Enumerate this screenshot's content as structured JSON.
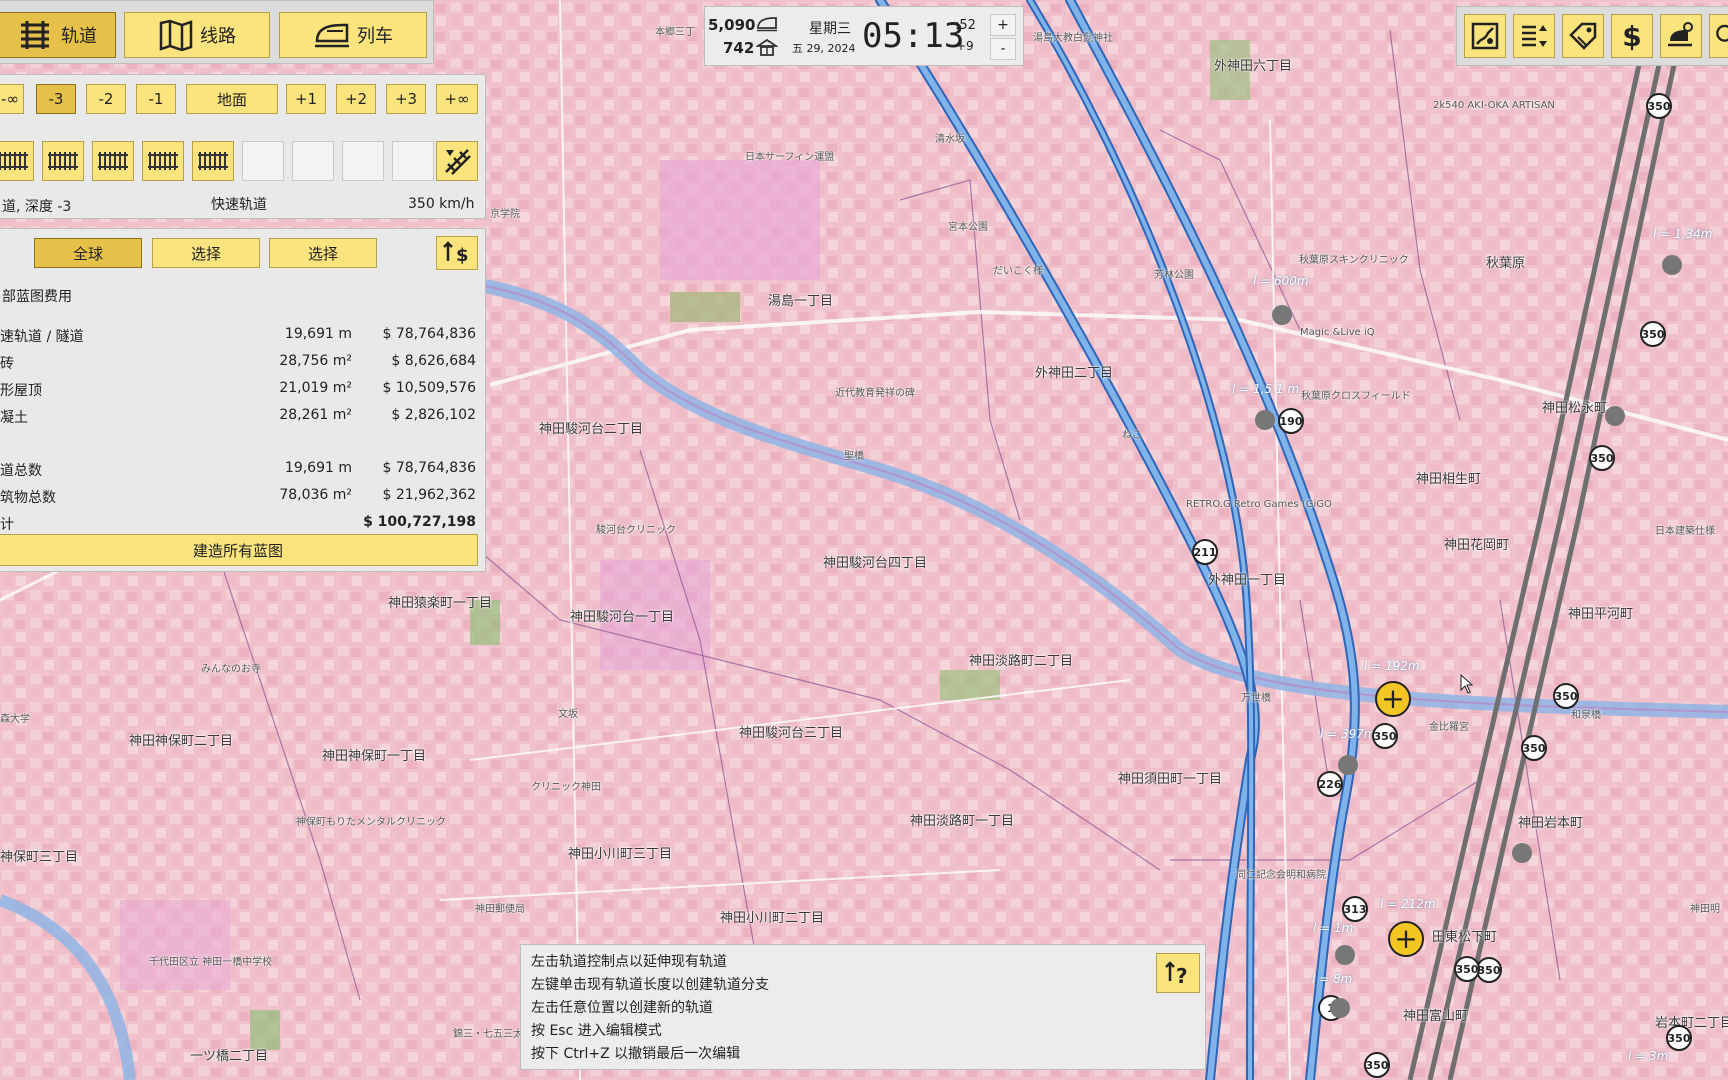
{
  "toolbar": {
    "tabs": [
      {
        "label": "轨道",
        "icon": "rail-track-icon"
      },
      {
        "label": "线路",
        "icon": "map-route-icon"
      },
      {
        "label": "列车",
        "icon": "train-icon"
      }
    ],
    "depth_levels": [
      "-∞",
      "-3",
      "-2",
      "-1",
      "地面",
      "+1",
      "+2",
      "+3",
      "+∞"
    ],
    "active_depth": "-3"
  },
  "track_panel": {
    "status_left": "道, 深度 -3",
    "status_middle": "快速轨道",
    "status_right": "350 km/h"
  },
  "cost_panel": {
    "scope_buttons": [
      "全球",
      "选择",
      "选择"
    ],
    "title": "部蓝图费用",
    "rows": [
      {
        "label": "速轨道 / 隧道",
        "qty": "19,691 m",
        "cost": "$ 78,764,836"
      },
      {
        "label": "砖",
        "qty": "28,756 m²",
        "cost": "$ 8,626,684"
      },
      {
        "label": "形屋顶",
        "qty": "21,019 m²",
        "cost": "$ 10,509,576"
      },
      {
        "label": "凝土",
        "qty": "28,261 m²",
        "cost": "$ 2,826,102"
      }
    ],
    "totals": [
      {
        "label": "道总数",
        "qty": "19,691 m",
        "cost": "$ 78,764,836"
      },
      {
        "label": "筑物总数",
        "qty": "78,036 m²",
        "cost": "$ 21,962,362"
      }
    ],
    "grand_total_label": "计",
    "grand_total": "$ 100,727,198",
    "build_all": "建造所有蓝图"
  },
  "clock": {
    "money_top": "5,090",
    "money_bottom": "742",
    "weekday": "星期三",
    "date": "五 29, 2024",
    "time": "05:13",
    "seconds": ":52",
    "speed": "+9",
    "plus": "+",
    "minus": "-"
  },
  "right_toolbar": {
    "icons": [
      "blueprint-map-icon",
      "sort-list-icon",
      "price-tag-icon",
      "dollar-icon",
      "rail-build-icon"
    ]
  },
  "hints": {
    "lines": [
      "左击轨道控制点以延伸现有轨道",
      "左键单击现有轨道长度以创建轨道分支",
      "左击任意位置以创建新的轨道",
      "按 Esc 进入编辑模式",
      "按下 Ctrl+Z 以撤销最后一次编辑"
    ]
  },
  "map": {
    "labels": [
      {
        "text": "外神田六丁目",
        "cls": ""
      },
      {
        "text": "湯島一丁目",
        "cls": ""
      },
      {
        "text": "外神田二丁目",
        "cls": ""
      },
      {
        "text": "秋葉原",
        "cls": ""
      },
      {
        "text": "神田駿河台二丁目",
        "cls": ""
      },
      {
        "text": "神田松永町",
        "cls": ""
      },
      {
        "text": "神田相生町",
        "cls": ""
      },
      {
        "text": "神田花岡町",
        "cls": ""
      },
      {
        "text": "神田駿河台四丁目",
        "cls": ""
      },
      {
        "text": "外神田一丁目",
        "cls": ""
      },
      {
        "text": "神田猿楽町一丁目",
        "cls": ""
      },
      {
        "text": "神田駿河台一丁目",
        "cls": ""
      },
      {
        "text": "神田平河町",
        "cls": ""
      },
      {
        "text": "神田淡路町二丁目",
        "cls": ""
      },
      {
        "text": "神田神保町二丁目",
        "cls": ""
      },
      {
        "text": "神田神保町一丁目",
        "cls": ""
      },
      {
        "text": "神田駿河台三丁目",
        "cls": ""
      },
      {
        "text": "神田須田町一丁目",
        "cls": ""
      },
      {
        "text": "神田淡路町一丁目",
        "cls": ""
      },
      {
        "text": "神田岩本町",
        "cls": ""
      },
      {
        "text": "神保町三丁目",
        "cls": ""
      },
      {
        "text": "神田小川町三丁目",
        "cls": ""
      },
      {
        "text": "神田小川町二丁目",
        "cls": ""
      },
      {
        "text": "田東松下町",
        "cls": ""
      },
      {
        "text": "神田富山町",
        "cls": ""
      },
      {
        "text": "一ツ橋二丁目",
        "cls": ""
      },
      {
        "text": "岩本町二丁目",
        "cls": ""
      },
      {
        "text": "本郷三丁",
        "cls": "small"
      },
      {
        "text": "湯島大教白髭神社",
        "cls": "small"
      },
      {
        "text": "日本サーフィン運盟",
        "cls": "small"
      },
      {
        "text": "近代教育発祥の碑",
        "cls": "small"
      },
      {
        "text": "聖橋",
        "cls": "small"
      },
      {
        "text": "駿河台クリニック",
        "cls": "small"
      },
      {
        "text": "みんなのお寺",
        "cls": "small"
      },
      {
        "text": "文坂",
        "cls": "small"
      },
      {
        "text": "クリニック神田",
        "cls": "small"
      },
      {
        "text": "神保町もりたメンタルクリニック",
        "cls": "small"
      },
      {
        "text": "神田郵便局",
        "cls": "small"
      },
      {
        "text": "千代田区立 神田一橋中学校",
        "cls": "small"
      },
      {
        "text": "錦三・七五三太公",
        "cls": "small"
      },
      {
        "text": "秋葉原スキンクリニック",
        "cls": "small"
      },
      {
        "text": "秋葉原クロスフィールド",
        "cls": "small"
      },
      {
        "text": "Magic &Live iQ",
        "cls": "small"
      },
      {
        "text": "RETRO.G Retro Games (GiGO",
        "cls": "small"
      },
      {
        "text": "万世橋",
        "cls": "small"
      },
      {
        "text": "金比羅宮",
        "cls": "small"
      },
      {
        "text": "和泉橋",
        "cls": "small"
      },
      {
        "text": "日本建築仕様",
        "cls": "small"
      },
      {
        "text": "2k540 AKI-OKA ARTISAN",
        "cls": "small"
      },
      {
        "text": "芳林公園",
        "cls": "small"
      },
      {
        "text": "宮本公園",
        "cls": "small"
      },
      {
        "text": "清水坂",
        "cls": "small"
      },
      {
        "text": "同仁記念会明和病院",
        "cls": "small"
      },
      {
        "text": "神田明",
        "cls": "small"
      },
      {
        "text": "だいこく様",
        "cls": "small"
      },
      {
        "text": "森大学",
        "cls": "small"
      },
      {
        "text": "京学院",
        "cls": "small"
      },
      {
        "text": "ねこ",
        "cls": "small"
      },
      {
        "text": "l = 600m",
        "cls": "italic"
      },
      {
        "text": "l = 1,5 1 m",
        "cls": "italic"
      },
      {
        "text": "l = 192m",
        "cls": "italic"
      },
      {
        "text": "l = 397m",
        "cls": "italic"
      },
      {
        "text": "l = 212m",
        "cls": "italic"
      },
      {
        "text": "l = 1m",
        "cls": "italic"
      },
      {
        "text": "l = 8m",
        "cls": "italic"
      },
      {
        "text": "l = 1,34m",
        "cls": "italic"
      },
      {
        "text": "l = 3m",
        "cls": "italic"
      }
    ],
    "route_badges": [
      "350",
      "350",
      "350",
      "190",
      "211",
      "350",
      "350",
      "226",
      "350",
      "313",
      "350",
      "350",
      "350",
      "350",
      "1"
    ]
  }
}
